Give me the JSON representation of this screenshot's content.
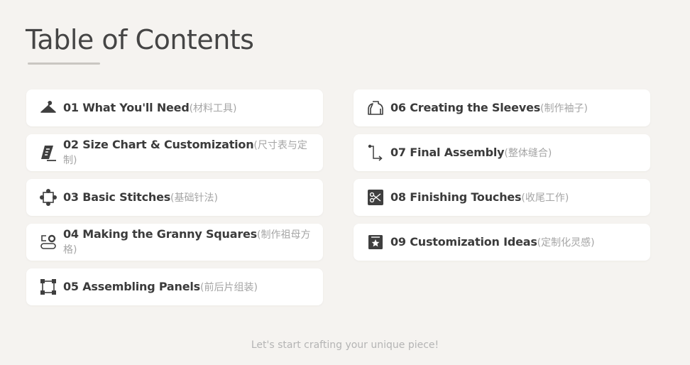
{
  "page": {
    "title": "Table of Contents",
    "footer": "Let's start crafting your unique piece!"
  },
  "colors": {
    "background": "#f5f3f0",
    "card": "#ffffff",
    "icon": "#3f3f3f",
    "subtitle": "#a5a5a5"
  },
  "sections": [
    {
      "main": "01 What You'll Need",
      "sub": "(材料工具)",
      "icon": "hanger-icon"
    },
    {
      "main": "06 Creating the Sleeves",
      "sub": "(制作袖子)",
      "icon": "shirt-icon"
    },
    {
      "main": "02 Size Chart & Customization",
      "sub": "(尺寸表与定制)",
      "icon": "ruler-icon"
    },
    {
      "main": "07 Final Assembly",
      "sub": "(整体缝合)",
      "icon": "path-arrow-icon"
    },
    {
      "main": "03 Basic Stitches",
      "sub": "(基础针法)",
      "icon": "stitch-nodes-icon"
    },
    {
      "main": "08 Finishing Touches",
      "sub": "(收尾工作)",
      "icon": "scissors-icon"
    },
    {
      "main": "04 Making the Granny Squares",
      "sub": "(制作祖母方格)",
      "icon": "granny-square-icon"
    },
    {
      "main": "09 Customization Ideas",
      "sub": "(定制化灵感)",
      "icon": "star-badge-icon"
    },
    {
      "main": "05 Assembling Panels",
      "sub": "(前后片组装)",
      "icon": "panel-frame-icon"
    }
  ]
}
